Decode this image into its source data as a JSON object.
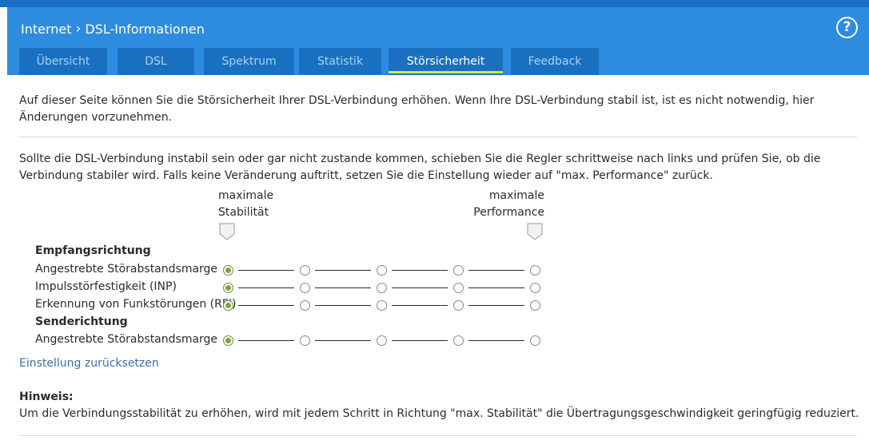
{
  "header": {
    "breadcrumb": [
      "Internet",
      "DSL-Informationen"
    ],
    "help_label": "?"
  },
  "tabs": [
    {
      "label": "Übersicht",
      "active": false
    },
    {
      "label": "DSL",
      "active": false
    },
    {
      "label": "Spektrum",
      "active": false
    },
    {
      "label": "Statistik",
      "active": false
    },
    {
      "label": "Störsicherheit",
      "active": true
    },
    {
      "label": "Feedback",
      "active": false
    }
  ],
  "intro_text": "Auf dieser Seite können Sie die Störsicherheit Ihrer DSL-Verbindung erhöhen. Wenn Ihre DSL-Verbindung stabil ist, ist es nicht notwendig, hier Änderungen vorzunehmen.",
  "instructions_text": "Sollte die DSL-Verbindung instabil sein oder gar nicht zustande kommen, schieben Sie die Regler schrittweise nach links und prüfen Sie, ob die Verbindung stabiler wird. Falls keine Veränderung auftritt, setzen Sie die Einstellung wieder auf \"max. Performance\" zurück.",
  "scale": {
    "left_label_line1": "maximale",
    "left_label_line2": "Stabilität",
    "right_label_line1": "maximale",
    "right_label_line2": "Performance"
  },
  "receive": {
    "title": "Empfangsrichtung",
    "rows": [
      {
        "label": "Angestrebte Störabstandsmarge",
        "selected": 0,
        "steps": 5
      },
      {
        "label": "Impulsstörfestigkeit (INP)",
        "selected": 0,
        "steps": 5
      },
      {
        "label": "Erkennung von Funkstörungen (RFI)",
        "selected": 0,
        "steps": 5
      }
    ]
  },
  "send": {
    "title": "Senderichtung",
    "rows": [
      {
        "label": "Angestrebte Störabstandsmarge",
        "selected": 0,
        "steps": 5
      }
    ]
  },
  "reset_link": "Einstellung zurücksetzen",
  "hint": {
    "title": "Hinweis:",
    "text": "Um die Verbindungsstabilität zu erhöhen, wird mit jedem Schritt in Richtung \"max. Stabilität\" die Übertragungsgeschwindigkeit geringfügig reduziert."
  },
  "colors": {
    "header_bg": "#2d8ce0",
    "tab_bg": "#1a70c0",
    "active_underline": "#d7e83e",
    "radio_checked": "#7ea43c",
    "link": "#3a6ea8"
  }
}
